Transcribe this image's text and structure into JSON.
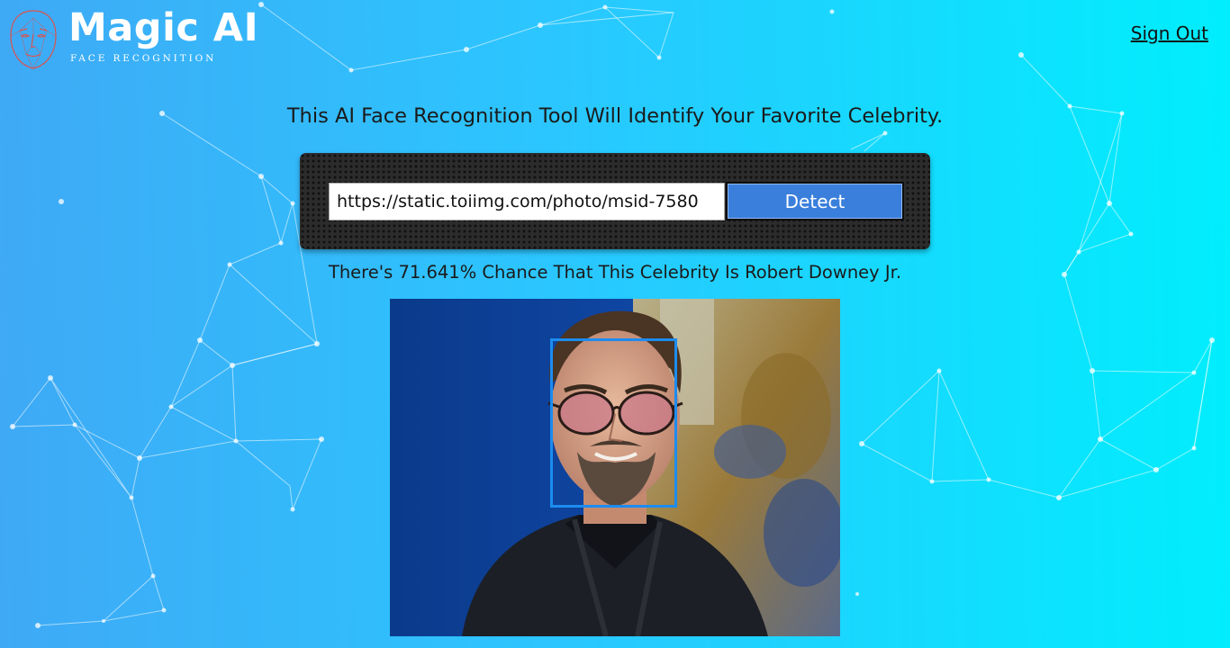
{
  "app": {
    "title": "Magic AI",
    "subtitle": "FACE RECOGNITION",
    "logo_icon": "face-mesh-icon"
  },
  "nav": {
    "sign_out_label": "Sign Out"
  },
  "main": {
    "headline": "This AI Face Recognition Tool Will Identify Your Favorite Celebrity.",
    "url_input": {
      "value": "https://static.toiimg.com/photo/msid-7580"
    },
    "detect_label": "Detect",
    "result_text": "There's 71.641% Chance That This Celebrity Is Robert Downey Jr."
  },
  "colors": {
    "bg_left": "#3fa9f5",
    "bg_right": "#00eefd",
    "button": "#3b7fdc",
    "face_box": "#1c8cf0",
    "panel": "#2c2c2c"
  }
}
